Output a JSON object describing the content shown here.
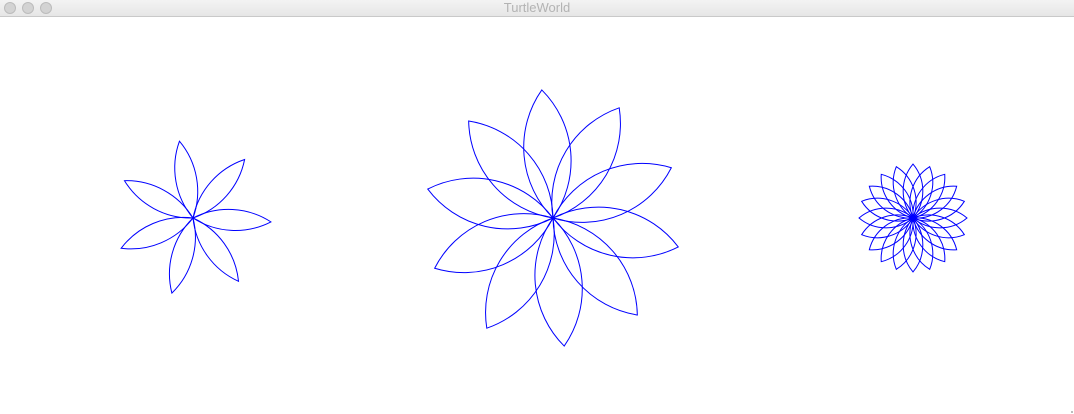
{
  "window": {
    "title": "TurtleWorld",
    "controls": {
      "close": "close-button",
      "minimize": "minimize-button",
      "zoom": "zoom-button"
    }
  },
  "canvas": {
    "background": "#ffffff",
    "stroke_color": "#0000ff",
    "flowers": [
      {
        "name": "flower-7-petals",
        "petals": 7,
        "radius": 60,
        "angle": 60
      },
      {
        "name": "flower-10-petals",
        "petals": 10,
        "radius": 80,
        "angle": 80
      },
      {
        "name": "flower-20-petals",
        "petals": 20,
        "radius": 40,
        "angle": 80
      }
    ]
  }
}
